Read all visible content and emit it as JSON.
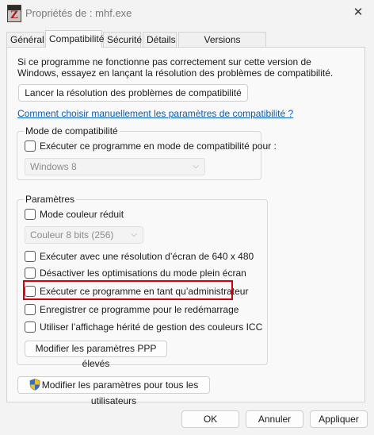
{
  "window": {
    "title": "Propriétés de : mhf.exe",
    "close_glyph": "✕",
    "icon_letter": "Z"
  },
  "tabs": [
    {
      "label": "Général"
    },
    {
      "label": "Compatibilité",
      "active": true
    },
    {
      "label": "Sécurité"
    },
    {
      "label": "Détails"
    },
    {
      "label": "Versions précédentes"
    }
  ],
  "compat": {
    "intro": "Si ce programme ne fonctionne pas correctement sur cette version de Windows, essayez en lançant la résolution des problèmes de compatibilité.",
    "troubleshoot_button": "Lancer la résolution des problèmes de compatibilité",
    "manual_link": "Comment choisir manuellement les paramètres de compatibilité ?",
    "mode_group": {
      "legend": "Mode de compatibilité",
      "checkbox_label": "Exécuter ce programme en mode de compatibilité pour :",
      "checked": false,
      "os_select_value": "Windows 8"
    },
    "settings_group": {
      "legend": "Paramètres",
      "reduced_color": {
        "label": "Mode couleur réduit",
        "checked": false
      },
      "color_select_value": "Couleur 8 bits (256)",
      "res_640": {
        "label": "Exécuter avec une résolution d’écran de 640 x 480",
        "checked": false
      },
      "disable_fullscreen": {
        "label": "Désactiver les optimisations du mode plein écran",
        "checked": false
      },
      "run_as_admin": {
        "label": "Exécuter ce programme en tant qu’administrateur",
        "checked": false
      },
      "register_restart": {
        "label": "Enregistrer ce programme pour le redémarrage",
        "checked": false
      },
      "legacy_icc": {
        "label": "Utiliser l’affichage hérité de gestion des couleurs ICC",
        "checked": false
      },
      "dpi_button": "Modifier les paramètres PPP élevés"
    },
    "all_users_button": "Modifier les paramètres pour tous les utilisateurs"
  },
  "footer": {
    "ok": "OK",
    "cancel": "Annuler",
    "apply": "Appliquer"
  },
  "colors": {
    "highlight": "#d4000f",
    "link": "#0a5cb8",
    "window_bg": "#f3f3f3",
    "panel_bg": "#f9f9f9"
  },
  "icons": {
    "app": "mhf-app-icon",
    "close": "close-icon",
    "shield": "uac-shield-icon",
    "chevron": "chevron-down-icon"
  }
}
